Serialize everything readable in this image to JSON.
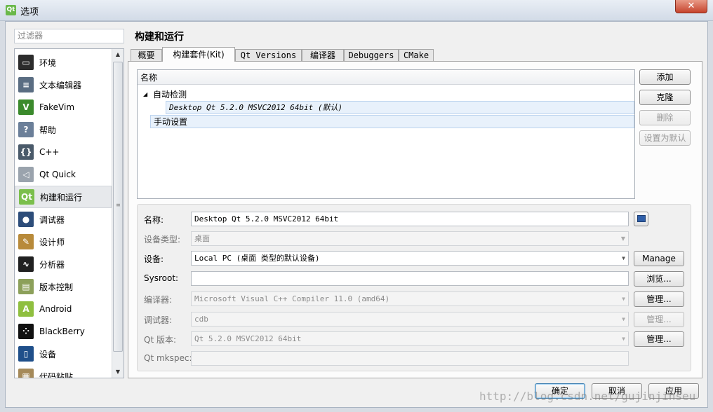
{
  "window": {
    "title": "选项",
    "app_icon_text": "Qt",
    "close_glyph": "✕"
  },
  "filter": {
    "placeholder": "过滤器"
  },
  "categories": [
    {
      "label": "环境",
      "icon": "monitor-icon",
      "color": "#2c2c2c",
      "glyph": "▭"
    },
    {
      "label": "文本编辑器",
      "icon": "text-editor-icon",
      "color": "#5a6d82",
      "glyph": "≡"
    },
    {
      "label": "FakeVim",
      "icon": "fakevim-icon",
      "color": "#3b8a2c",
      "glyph": "V"
    },
    {
      "label": "帮助",
      "icon": "help-icon",
      "color": "#6b7f99",
      "glyph": "?"
    },
    {
      "label": "C++",
      "icon": "cpp-icon",
      "color": "#4a5a6a",
      "glyph": "{}"
    },
    {
      "label": "Qt Quick",
      "icon": "qt-quick-icon",
      "color": "#9aa3ad",
      "glyph": "◁"
    },
    {
      "label": "构建和运行",
      "icon": "build-run-icon",
      "color": "#7bbf4c",
      "glyph": "Qt",
      "selected": true
    },
    {
      "label": "调试器",
      "icon": "debugger-icon",
      "color": "#2d4d7a",
      "glyph": "●"
    },
    {
      "label": "设计师",
      "icon": "designer-icon",
      "color": "#b88a3a",
      "glyph": "✎"
    },
    {
      "label": "分析器",
      "icon": "analyzer-icon",
      "color": "#202020",
      "glyph": "∿"
    },
    {
      "label": "版本控制",
      "icon": "version-control-icon",
      "color": "#8ca05a",
      "glyph": "▤"
    },
    {
      "label": "Android",
      "icon": "android-icon",
      "color": "#8fbf3f",
      "glyph": "A"
    },
    {
      "label": "BlackBerry",
      "icon": "blackberry-icon",
      "color": "#111111",
      "glyph": "⁘"
    },
    {
      "label": "设备",
      "icon": "device-icon",
      "color": "#1f4f8a",
      "glyph": "▯"
    },
    {
      "label": "代码粘贴",
      "icon": "code-paste-icon",
      "color": "#a58a5a",
      "glyph": "▦"
    }
  ],
  "page": {
    "title": "构建和运行"
  },
  "tabs": [
    {
      "label": "概要"
    },
    {
      "label": "构建套件(Kit)",
      "active": true
    },
    {
      "label": "Qt Versions"
    },
    {
      "label": "编译器"
    },
    {
      "label": "Debuggers"
    },
    {
      "label": "CMake"
    }
  ],
  "kit_tree": {
    "header": "名称",
    "auto_group": "自动检测",
    "auto_kit": "Desktop Qt 5.2.0 MSVC2012 64bit (默认)",
    "manual_group": "手动设置"
  },
  "kit_buttons": {
    "add": "添加",
    "clone": "克隆",
    "remove": "删除",
    "make_default": "设置为默认"
  },
  "form": {
    "name_label": "名称:",
    "name_value": "Desktop Qt 5.2.0 MSVC2012 64bit",
    "device_type_label": "设备类型:",
    "device_type_value": "桌面",
    "device_label": "设备:",
    "device_value": "Local PC (桌面 类型的默认设备)",
    "device_button": "Manage",
    "sysroot_label": "Sysroot:",
    "sysroot_value": "",
    "sysroot_button": "浏览...",
    "compiler_label": "编译器:",
    "compiler_value": "Microsoft Visual C++ Compiler 11.0 (amd64)",
    "compiler_button": "管理...",
    "debugger_label": "调试器:",
    "debugger_value": "cdb",
    "debugger_button": "管理...",
    "qt_version_label": "Qt 版本:",
    "qt_version_value": "Qt 5.2.0 MSVC2012 64bit",
    "qt_version_button": "管理...",
    "mkspec_label": "Qt mkspec:",
    "mkspec_value": ""
  },
  "dialog_buttons": {
    "ok": "确定",
    "cancel": "取消",
    "apply": "应用"
  },
  "watermark": "http://blog.csdn.net/gujinjinseu"
}
